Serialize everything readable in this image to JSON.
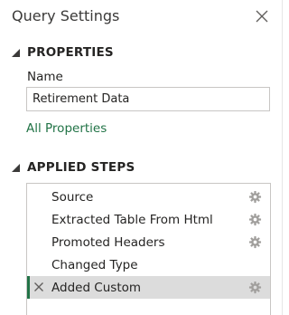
{
  "pane": {
    "title": "Query Settings",
    "close_icon": "close-icon"
  },
  "properties": {
    "heading": "PROPERTIES",
    "name_label": "Name",
    "name_value": "Retirement Data",
    "all_properties_link": "All Properties"
  },
  "applied_steps": {
    "heading": "APPLIED STEPS",
    "items": [
      {
        "label": "Source",
        "has_gear": true,
        "selected": false
      },
      {
        "label": "Extracted Table From Html",
        "has_gear": true,
        "selected": false
      },
      {
        "label": "Promoted Headers",
        "has_gear": true,
        "selected": false
      },
      {
        "label": "Changed Type",
        "has_gear": false,
        "selected": false
      },
      {
        "label": "Added Custom",
        "has_gear": true,
        "selected": true
      }
    ]
  },
  "colors": {
    "accent": "#217346",
    "selected_row": "#dcdcdc",
    "border": "#c8c6c4"
  }
}
